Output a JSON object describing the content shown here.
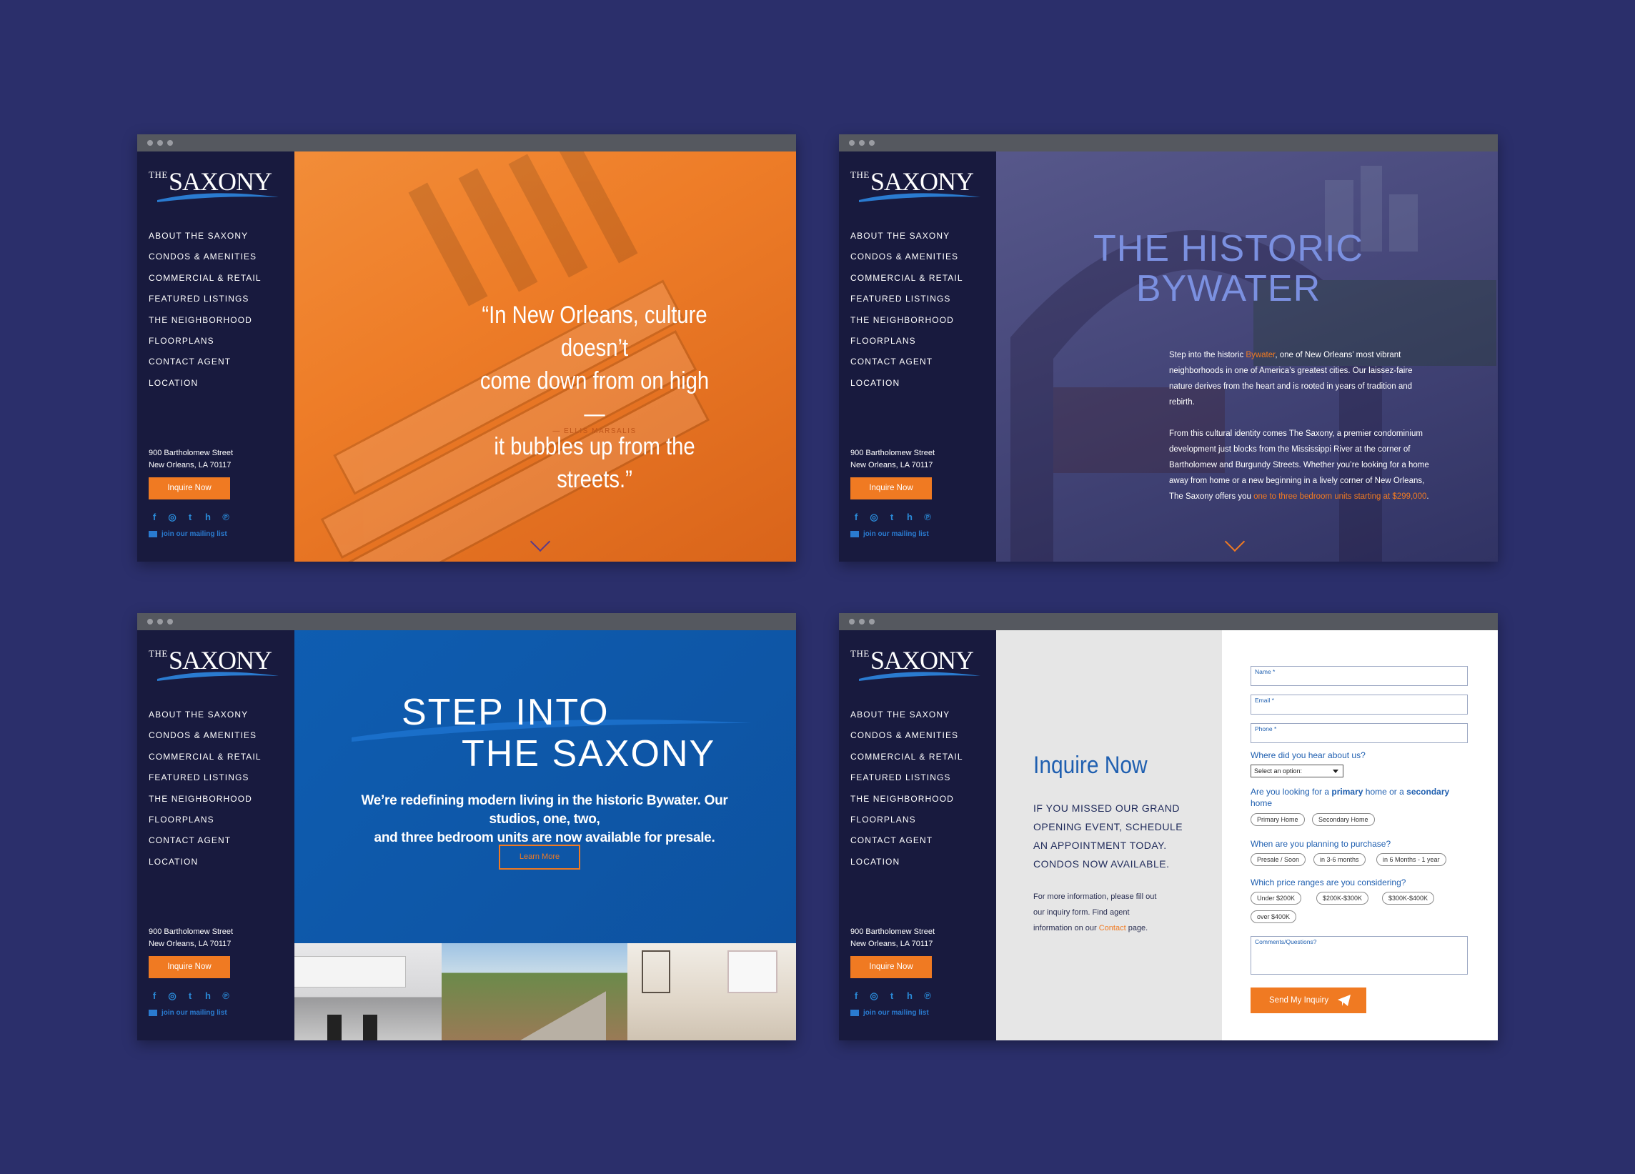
{
  "brand": {
    "the": "THE",
    "name": "SAXONY"
  },
  "nav": [
    "ABOUT THE SAXONY",
    "CONDOS & AMENITIES",
    "COMMERCIAL & RETAIL",
    "FEATURED LISTINGS",
    "THE NEIGHBORHOOD",
    "FLOORPLANS",
    "CONTACT AGENT",
    "LOCATION"
  ],
  "address": {
    "line1": "900 Bartholomew Street",
    "line2": "New Orleans, LA 70117"
  },
  "inquire_label": "Inquire Now",
  "social_icons": [
    "facebook-icon",
    "instagram-icon",
    "twitter-icon",
    "houzz-icon",
    "pinterest-icon"
  ],
  "mailing_label": "join our mailing list",
  "colors": {
    "background": "#2b2f6b",
    "sidebar": "#181a3e",
    "accent": "#f07a22",
    "link_blue": "#2a7bd0"
  },
  "w1": {
    "quote_l1": "“In New Orleans, culture doesn’t",
    "quote_l2": "come down from on high —",
    "quote_l3": "it bubbles up from the streets.”",
    "byline": "— ELLIS MARSALIS"
  },
  "w2": {
    "title_l1": "THE HISTORIC",
    "title_l2": "BYWATER",
    "p1_a": "Step into the historic ",
    "p1_link": "Bywater",
    "p1_b": ", one of New Orleans’ most vibrant neighborhoods in one of America’s greatest cities. Our laissez-faire nature derives from the heart and is rooted in years of tradition and rebirth.",
    "p2_a": "From this cultural identity comes The Saxony, a premier condominium development just blocks from the Mississippi River at the corner of Bartholomew and Burgundy Streets. Whether you’re looking for a home away from home or a new beginning in a lively corner of New Orleans, The Saxony offers you ",
    "p2_link": "one to three bedroom units starting at $299,000",
    "p2_b": "."
  },
  "w3": {
    "title_l1": "STEP INTO",
    "title_l2": "THE SAXONY",
    "sub_l1": "We’re redefining modern living in the historic Bywater. Our studios, one, two,",
    "sub_l2": "and three bedroom units are now available for presale.",
    "learn": "Learn More"
  },
  "w4": {
    "title": "Inquire Now",
    "sub_l1": "IF YOU MISSED OUR GRAND",
    "sub_l2": "OPENING EVENT, SCHEDULE",
    "sub_l3": "AN APPOINTMENT TODAY.",
    "sub_l4": "CONDOS NOW AVAILABLE.",
    "info_l1": "For more information, please fill out",
    "info_l2": "our inquiry form. Find agent",
    "info_l3_a": "information on our ",
    "info_l3_link": "Contact",
    "info_l3_b": " page.",
    "name_label": "Name *",
    "email_label": "Email *",
    "phone_label": "Phone *",
    "q_hear": "Where did you hear about us?",
    "select_value": "Select an option:",
    "q_look_a": "Are you looking for a ",
    "q_look_primary": "primary",
    "q_look_b": " home or a ",
    "q_look_secondary": "secondary",
    "q_look_c": "home",
    "home_options": [
      "Primary Home",
      "Secondary Home"
    ],
    "q_when": "When are you planning to purchase?",
    "when_options": [
      "Presale / Soon",
      "in 3-6 months",
      "in 6 Months - 1 year"
    ],
    "q_price": "Which price ranges are you considering?",
    "price_options": [
      "Under $200K",
      "$200K-$300K",
      "$300K-$400K",
      "over $400K"
    ],
    "comments_label": "Comments/Questions?",
    "send_label": "Send My Inquiry"
  }
}
